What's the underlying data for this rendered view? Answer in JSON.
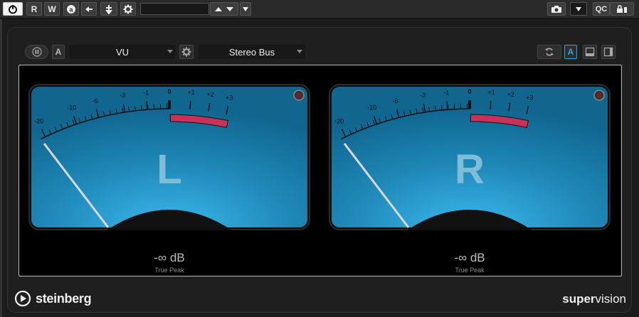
{
  "host_toolbar": {
    "power_icon": "power-icon",
    "read_label": "R",
    "write_label": "W",
    "qc_label": "QC",
    "preset_value": ""
  },
  "plugin_toolbar": {
    "meter_type": "VU",
    "a_label": "A",
    "bus": "Stereo Bus",
    "a_active_label": "A"
  },
  "meters": [
    {
      "channel": "L",
      "value": "-∞ dB",
      "caption": "True Peak",
      "scale_labels": [
        "-20",
        "-10",
        "-6",
        "-3",
        "-1",
        "0",
        "+1",
        "+2",
        "+3"
      ]
    },
    {
      "channel": "R",
      "value": "-∞ dB",
      "caption": "True Peak",
      "scale_labels": [
        "-20",
        "-10",
        "-6",
        "-3",
        "-1",
        "0",
        "+1",
        "+2",
        "+3"
      ]
    }
  ],
  "footer": {
    "brand": "steinberg",
    "product_a": "super",
    "product_b": "vision"
  },
  "colors": {
    "meter_face": "#1e86b5",
    "meter_glow": "#3ab8ee",
    "red_zone": "#c8325a",
    "active_accent": "#2aa6e0"
  }
}
